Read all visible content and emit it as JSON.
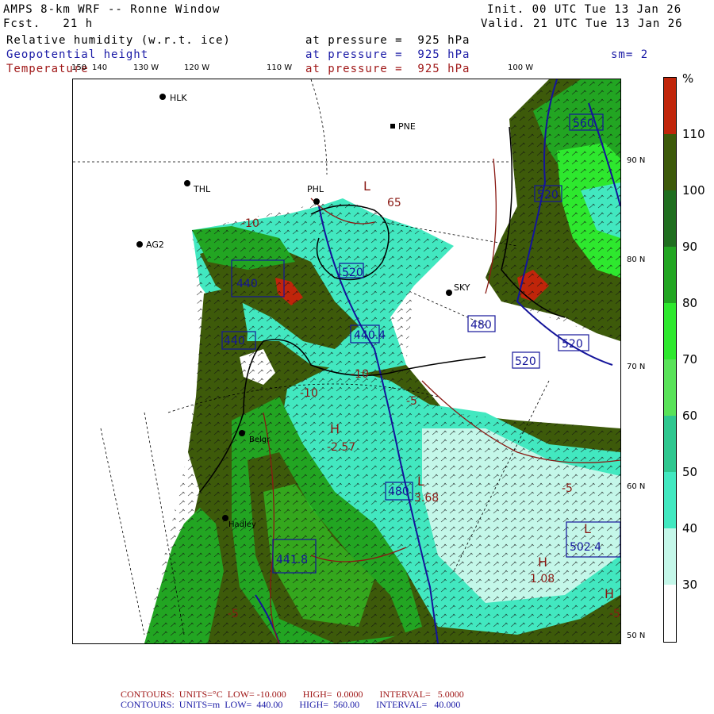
{
  "header": {
    "title": "AMPS 8-km WRF -- Ronne Window",
    "fcst": "Fcst.   21 h",
    "init": "Init. 00 UTC Tue 13 Jan 26",
    "valid": "Valid. 21 UTC Tue 13 Jan 26",
    "field1": "Relative humidity (w.r.t. ice)",
    "field2": "Geopotential height",
    "field3": "Temperature",
    "pressure1": "at pressure =  925 hPa",
    "pressure2": "at pressure =  925 hPa",
    "pressure3": "at pressure =  925 hPa",
    "sm": "sm= 2"
  },
  "lon_labels": [
    "150",
    "140",
    "130 W",
    "120 W",
    "110 W",
    "100 W"
  ],
  "lat_labels": [
    "90 N",
    "80 N",
    "70 N",
    "60 N",
    "50 N"
  ],
  "stations": [
    "HLK",
    "PNE",
    "THL",
    "PHL",
    "AG2",
    "SKY",
    "Belgr",
    "Hadley"
  ],
  "colorbar": {
    "unit": "%",
    "labels": [
      "110",
      "100",
      "90",
      "80",
      "70",
      "60",
      "50",
      "40",
      "30"
    ],
    "colors": [
      "#c0250a",
      "#3d5a0a",
      "#1f6e1f",
      "#22a522",
      "#2ee82e",
      "#59e259",
      "#2fc78f",
      "#42e8c0",
      "#c4f7e9",
      "#ffffff"
    ]
  },
  "contour_labels": {
    "height": [
      "560",
      "520",
      "480",
      "440",
      "520",
      "520",
      "520",
      "440",
      "480",
      "441.8",
      "502.4",
      "440.4"
    ],
    "temp": [
      "-10",
      "-5",
      "-10",
      "-5",
      "-5",
      "-5",
      "-10"
    ],
    "extrema": [
      "L",
      "H",
      "L",
      "H",
      "H",
      "L"
    ],
    "extrema_values": [
      "-2.57",
      "3.68",
      "1.08",
      "65"
    ]
  },
  "footer": {
    "line1": "CONTOURS:  UNITS=°C  LOW= -10.000       HIGH=  0.0000       INTERVAL=   5.0000",
    "line2": "CONTOURS:  UNITS=m  LOW=  440.00       HIGH=  560.00       INTERVAL=   40.000"
  }
}
